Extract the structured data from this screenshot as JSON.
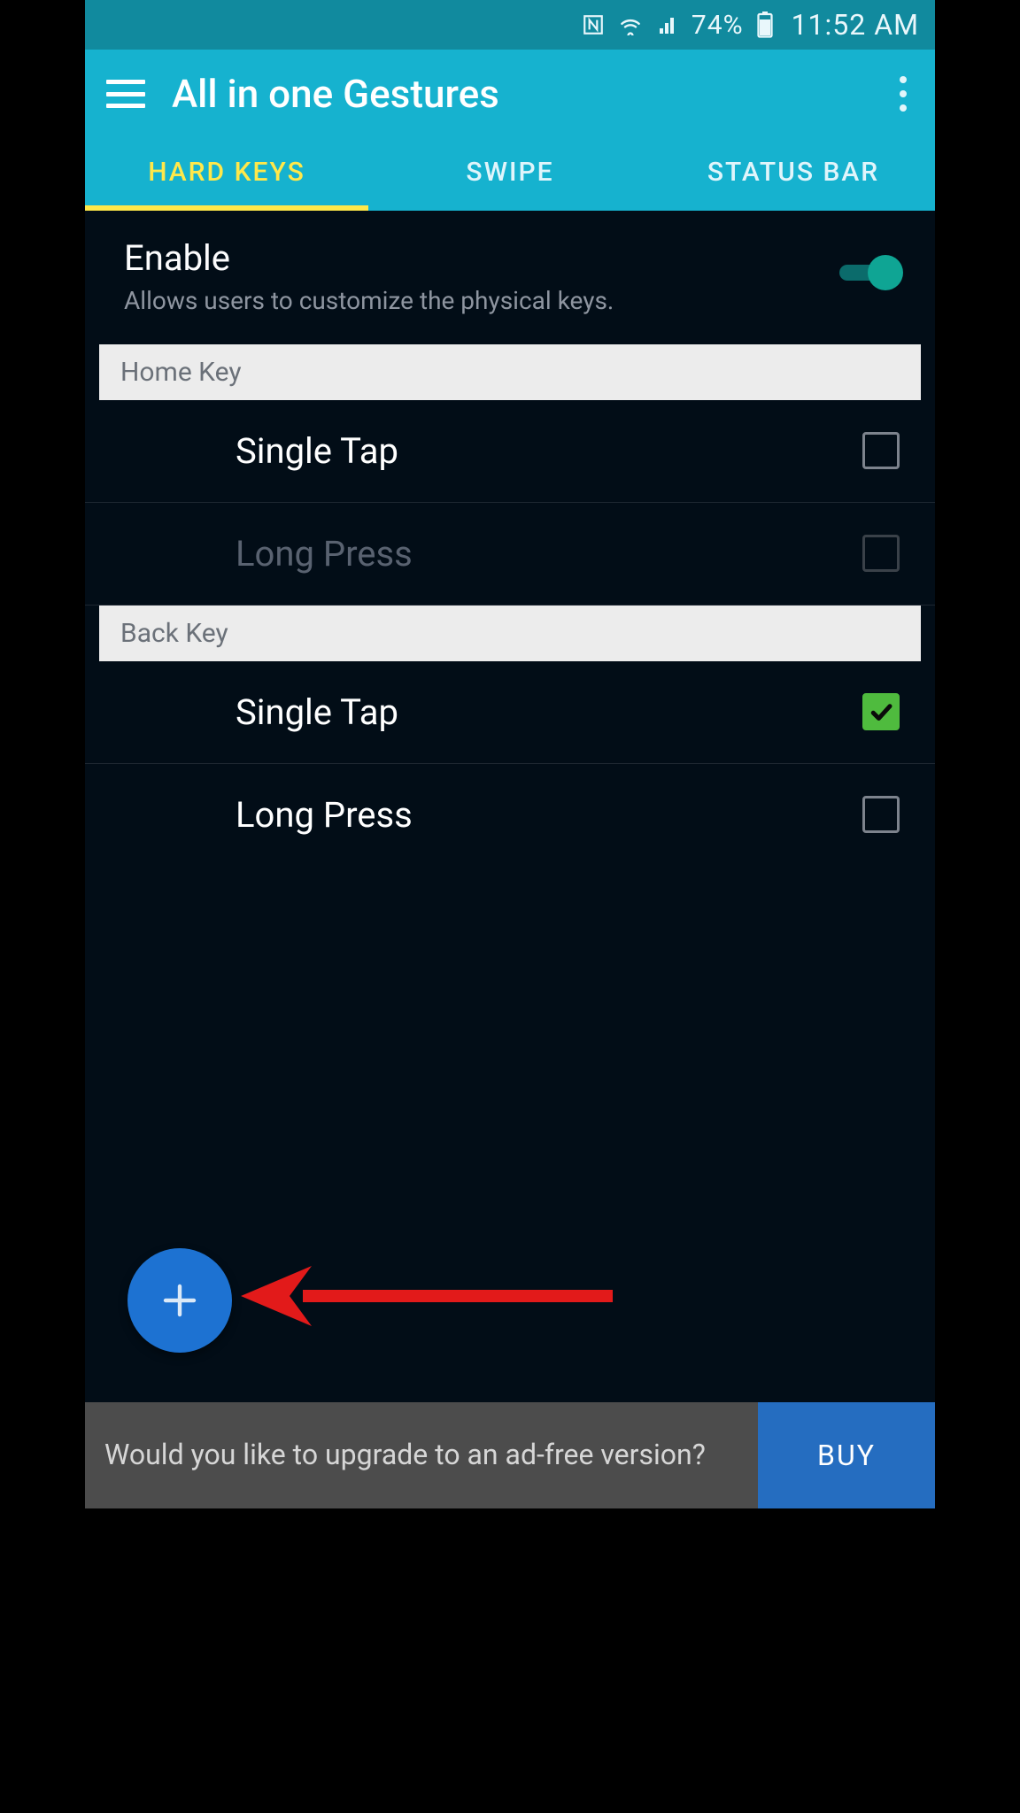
{
  "statusbar": {
    "battery_pct": "74%",
    "time": "11:52 AM"
  },
  "appbar": {
    "title": "All in one Gestures"
  },
  "tabs": [
    {
      "label": "HARD KEYS",
      "active": true
    },
    {
      "label": "SWIPE",
      "active": false
    },
    {
      "label": "STATUS BAR",
      "active": false
    }
  ],
  "enable": {
    "title": "Enable",
    "subtitle": "Allows users to customize the physical keys.",
    "value": true
  },
  "sections": [
    {
      "header": "Home Key",
      "rows": [
        {
          "label": "Single Tap",
          "checked": false,
          "disabled": false
        },
        {
          "label": "Long Press",
          "checked": false,
          "disabled": true
        }
      ]
    },
    {
      "header": "Back Key",
      "rows": [
        {
          "label": "Single Tap",
          "checked": true,
          "disabled": false
        },
        {
          "label": "Long Press",
          "checked": false,
          "disabled": false
        }
      ]
    }
  ],
  "buybar": {
    "message": "Would you like to upgrade to an ad-free version?",
    "button": "BUY"
  }
}
